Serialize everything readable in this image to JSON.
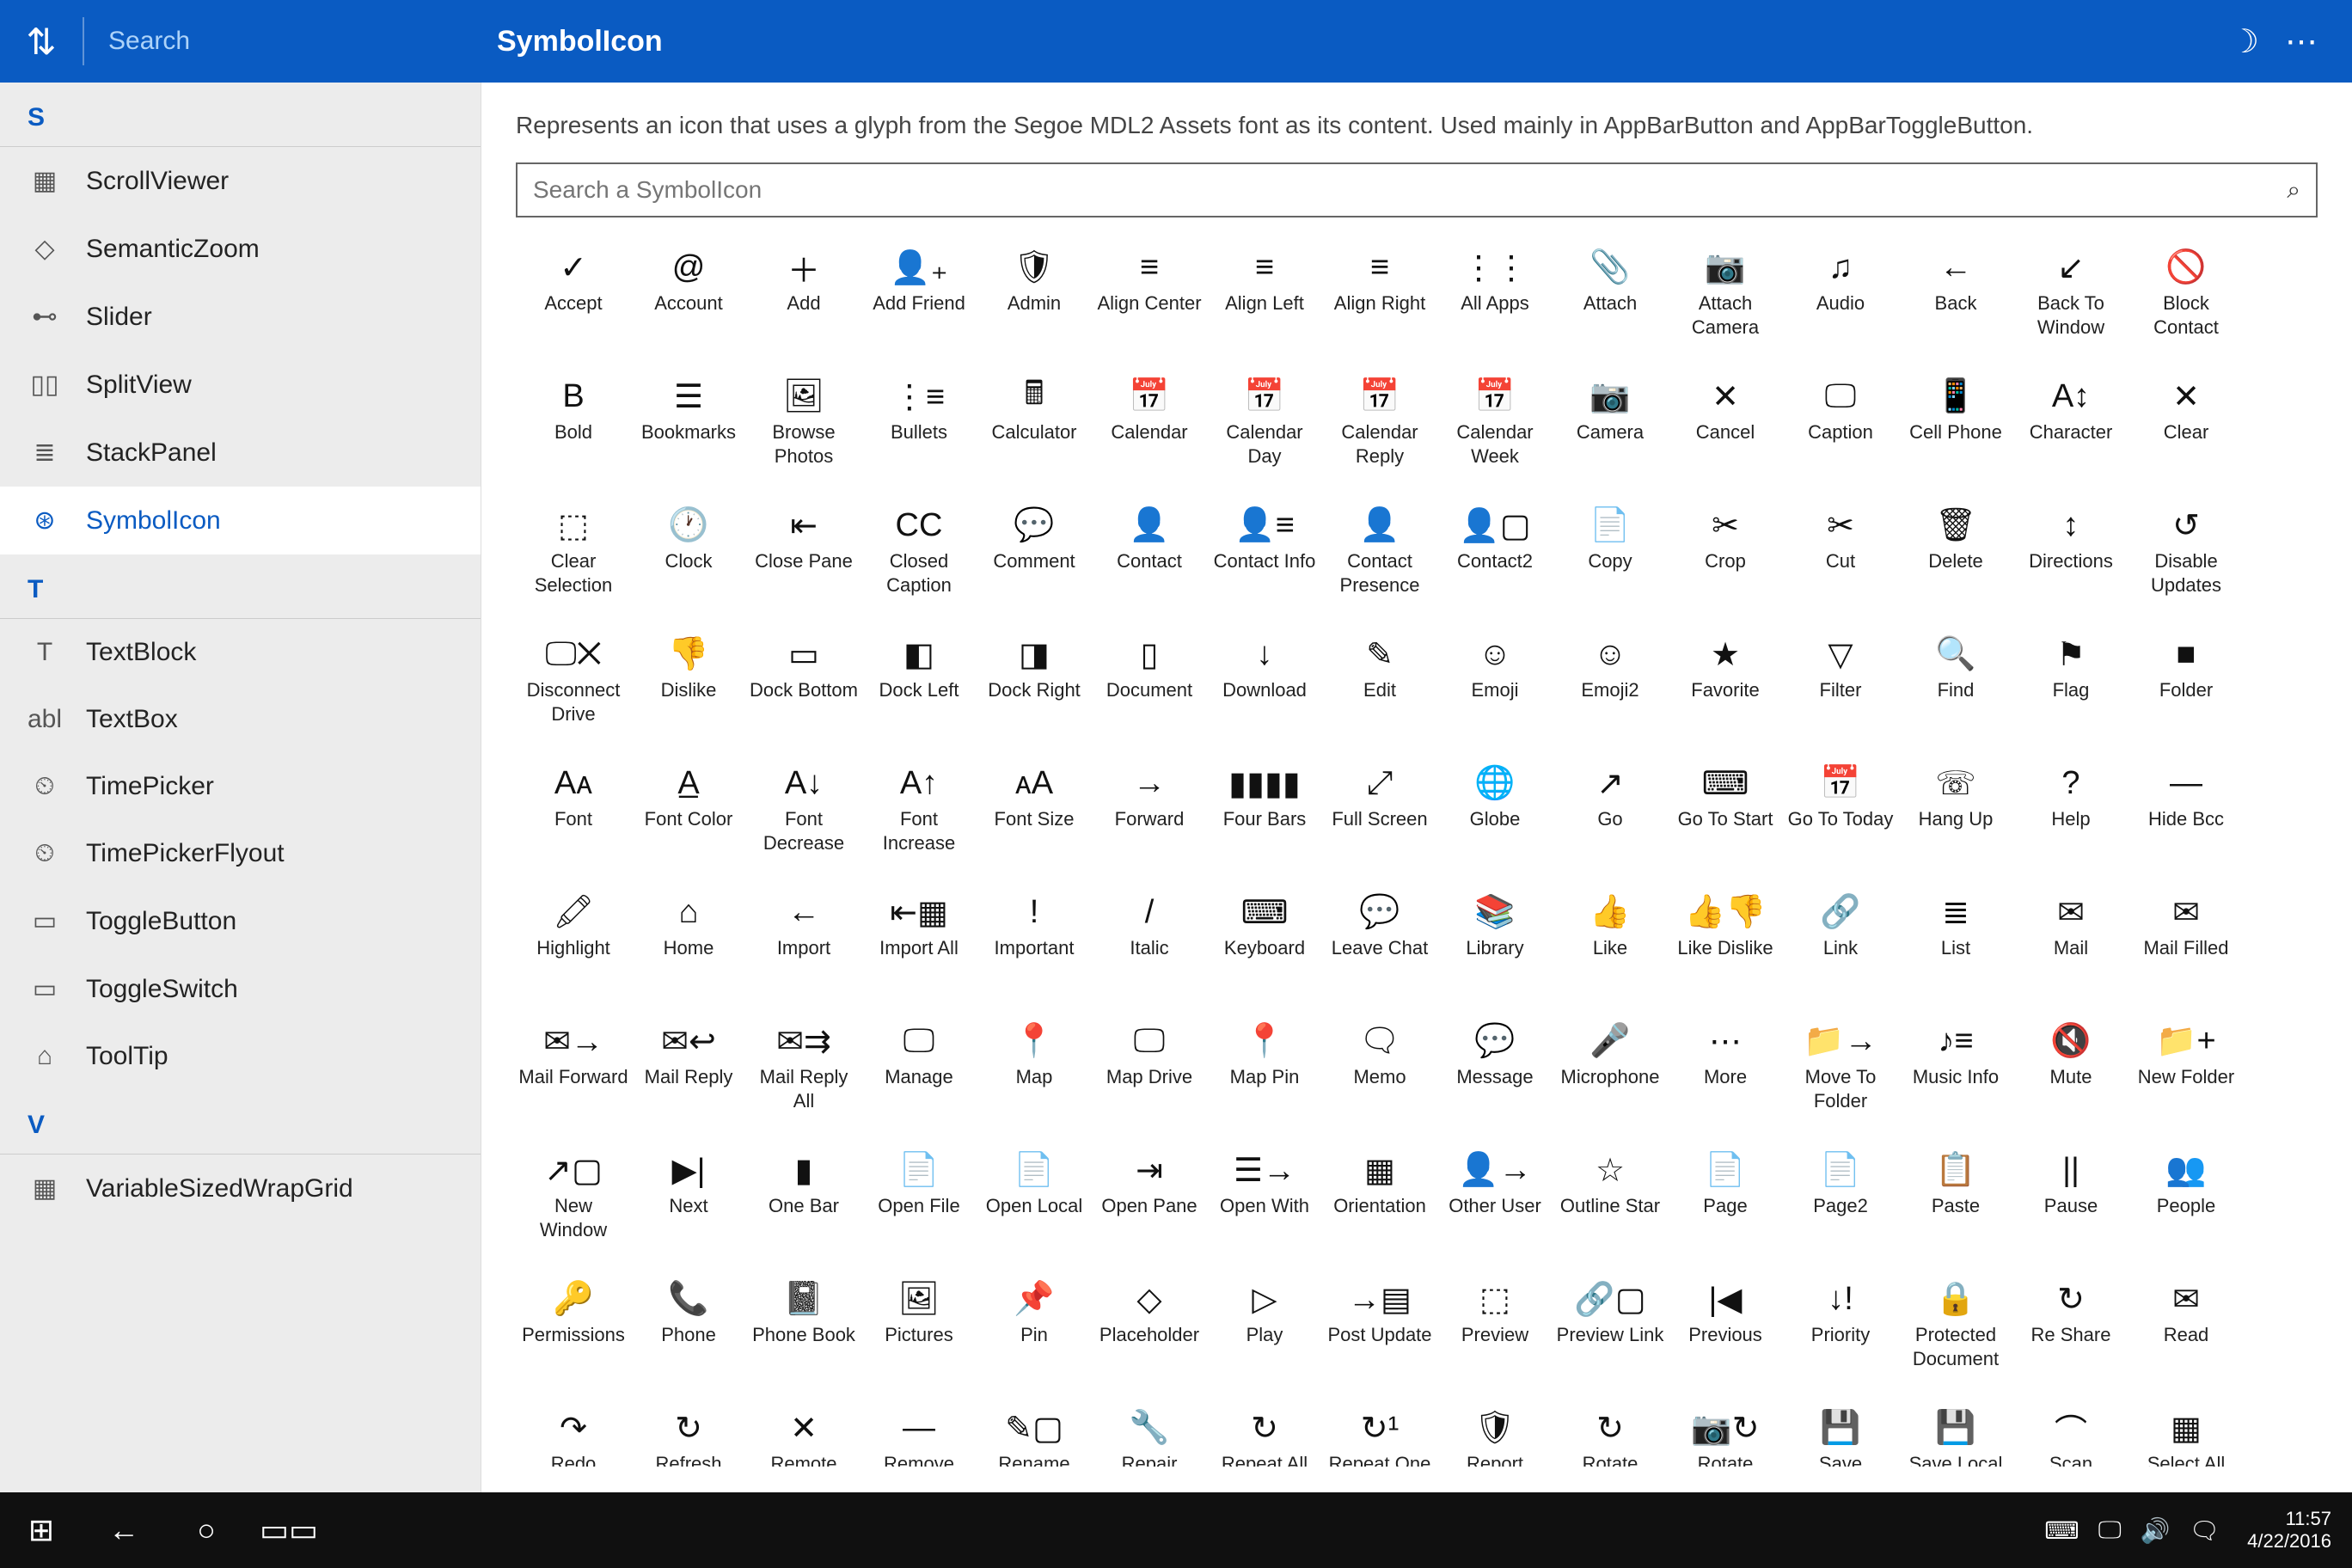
{
  "topbar": {
    "sort_glyph": "⇅",
    "search_placeholder": "Search",
    "title": "SymbolIcon",
    "theme_glyph": "☽",
    "more_glyph": "⋯"
  },
  "sidebar": {
    "groups": [
      {
        "letter": "S",
        "items": [
          {
            "icon": "▦",
            "label": "ScrollViewer",
            "id": "scrollviewer"
          },
          {
            "icon": "◇",
            "label": "SemanticZoom",
            "id": "semanticzoom"
          },
          {
            "icon": "⊷",
            "label": "Slider",
            "id": "slider"
          },
          {
            "icon": "▯▯",
            "label": "SplitView",
            "id": "splitview"
          },
          {
            "icon": "≣",
            "label": "StackPanel",
            "id": "stackpanel"
          },
          {
            "icon": "⊛",
            "label": "SymbolIcon",
            "id": "symbolicon",
            "active": true
          }
        ]
      },
      {
        "letter": "T",
        "items": [
          {
            "icon": "T",
            "label": "TextBlock",
            "id": "textblock"
          },
          {
            "icon": "abl",
            "label": "TextBox",
            "id": "textbox"
          },
          {
            "icon": "⏲",
            "label": "TimePicker",
            "id": "timepicker"
          },
          {
            "icon": "⏲",
            "label": "TimePickerFlyout",
            "id": "timepickerflyout"
          },
          {
            "icon": "▭",
            "label": "ToggleButton",
            "id": "togglebutton"
          },
          {
            "icon": "▭",
            "label": "ToggleSwitch",
            "id": "toggleswitch"
          },
          {
            "icon": "⌂",
            "label": "ToolTip",
            "id": "tooltip"
          }
        ]
      },
      {
        "letter": "V",
        "items": [
          {
            "icon": "▦",
            "label": "VariableSizedWrapGrid",
            "id": "variablesizedwrapgrid"
          }
        ]
      }
    ]
  },
  "content": {
    "description": "Represents an icon that uses a glyph from the Segoe MDL2 Assets font as its content. Used mainly in AppBarButton and AppBarToggleButton.",
    "search_placeholder": "Search a SymbolIcon",
    "search_icon_glyph": "⌕"
  },
  "symbols": [
    {
      "g": "✓",
      "l": "Accept"
    },
    {
      "g": "@",
      "l": "Account"
    },
    {
      "g": "＋",
      "l": "Add"
    },
    {
      "g": "👤₊",
      "l": "Add Friend"
    },
    {
      "g": "🛡",
      "l": "Admin"
    },
    {
      "g": "≡",
      "l": "Align Center"
    },
    {
      "g": "≡",
      "l": "Align Left"
    },
    {
      "g": "≡",
      "l": "Align Right"
    },
    {
      "g": "⋮⋮",
      "l": "All Apps"
    },
    {
      "g": "📎",
      "l": "Attach"
    },
    {
      "g": "📷",
      "l": "Attach Camera"
    },
    {
      "g": "♫",
      "l": "Audio"
    },
    {
      "g": "←",
      "l": "Back"
    },
    {
      "g": "↙",
      "l": "Back To Window"
    },
    {
      "g": "🚫",
      "l": "Block Contact"
    },
    {
      "g": "B",
      "l": "Bold"
    },
    {
      "g": "☰",
      "l": "Bookmarks"
    },
    {
      "g": "🖼",
      "l": "Browse Photos"
    },
    {
      "g": "⋮≡",
      "l": "Bullets"
    },
    {
      "g": "🖩",
      "l": "Calculator"
    },
    {
      "g": "📅",
      "l": "Calendar"
    },
    {
      "g": "📅",
      "l": "Calendar Day"
    },
    {
      "g": "📅",
      "l": "Calendar Reply"
    },
    {
      "g": "📅",
      "l": "Calendar Week"
    },
    {
      "g": "📷",
      "l": "Camera"
    },
    {
      "g": "✕",
      "l": "Cancel"
    },
    {
      "g": "🖵",
      "l": "Caption"
    },
    {
      "g": "📱",
      "l": "Cell Phone"
    },
    {
      "g": "A↕",
      "l": "Character"
    },
    {
      "g": "✕",
      "l": "Clear"
    },
    {
      "g": "⬚",
      "l": "Clear Selection"
    },
    {
      "g": "🕐",
      "l": "Clock"
    },
    {
      "g": "⇤",
      "l": "Close Pane"
    },
    {
      "g": "CC",
      "l": "Closed Caption"
    },
    {
      "g": "💬",
      "l": "Comment"
    },
    {
      "g": "👤",
      "l": "Contact"
    },
    {
      "g": "👤≡",
      "l": "Contact Info"
    },
    {
      "g": "👤",
      "l": "Contact Presence"
    },
    {
      "g": "👤▢",
      "l": "Contact2"
    },
    {
      "g": "📄",
      "l": "Copy"
    },
    {
      "g": "✂",
      "l": "Crop"
    },
    {
      "g": "✂",
      "l": "Cut"
    },
    {
      "g": "🗑",
      "l": "Delete"
    },
    {
      "g": "↕",
      "l": "Directions"
    },
    {
      "g": "↺",
      "l": "Disable Updates"
    },
    {
      "g": "🖵✕",
      "l": "Disconnect Drive"
    },
    {
      "g": "👎",
      "l": "Dislike"
    },
    {
      "g": "▭",
      "l": "Dock Bottom"
    },
    {
      "g": "◧",
      "l": "Dock Left"
    },
    {
      "g": "◨",
      "l": "Dock Right"
    },
    {
      "g": "▯",
      "l": "Document"
    },
    {
      "g": "↓",
      "l": "Download"
    },
    {
      "g": "✎",
      "l": "Edit"
    },
    {
      "g": "☺",
      "l": "Emoji"
    },
    {
      "g": "☺",
      "l": "Emoji2"
    },
    {
      "g": "★",
      "l": "Favorite"
    },
    {
      "g": "▽",
      "l": "Filter"
    },
    {
      "g": "🔍",
      "l": "Find"
    },
    {
      "g": "⚑",
      "l": "Flag"
    },
    {
      "g": "■",
      "l": "Folder"
    },
    {
      "g": "Aᴀ",
      "l": "Font"
    },
    {
      "g": "A̲",
      "l": "Font Color"
    },
    {
      "g": "A↓",
      "l": "Font Decrease"
    },
    {
      "g": "A↑",
      "l": "Font Increase"
    },
    {
      "g": "ᴀA",
      "l": "Font Size"
    },
    {
      "g": "→",
      "l": "Forward"
    },
    {
      "g": "▮▮▮▮",
      "l": "Four Bars"
    },
    {
      "g": "⤢",
      "l": "Full Screen"
    },
    {
      "g": "🌐",
      "l": "Globe"
    },
    {
      "g": "↗",
      "l": "Go"
    },
    {
      "g": "⌨",
      "l": "Go To Start"
    },
    {
      "g": "📅",
      "l": "Go To Today"
    },
    {
      "g": "☏",
      "l": "Hang Up"
    },
    {
      "g": "?",
      "l": "Help"
    },
    {
      "g": "—",
      "l": "Hide Bcc"
    },
    {
      "g": "🖍",
      "l": "Highlight"
    },
    {
      "g": "⌂",
      "l": "Home"
    },
    {
      "g": "←",
      "l": "Import"
    },
    {
      "g": "⇤▦",
      "l": "Import All"
    },
    {
      "g": "!",
      "l": "Important"
    },
    {
      "g": "/",
      "l": "Italic"
    },
    {
      "g": "⌨",
      "l": "Keyboard"
    },
    {
      "g": "💬",
      "l": "Leave Chat"
    },
    {
      "g": "📚",
      "l": "Library"
    },
    {
      "g": "👍",
      "l": "Like"
    },
    {
      "g": "👍👎",
      "l": "Like Dislike"
    },
    {
      "g": "🔗",
      "l": "Link"
    },
    {
      "g": "≣",
      "l": "List"
    },
    {
      "g": "✉",
      "l": "Mail"
    },
    {
      "g": "✉",
      "l": "Mail Filled"
    },
    {
      "g": "✉→",
      "l": "Mail Forward"
    },
    {
      "g": "✉↩",
      "l": "Mail Reply"
    },
    {
      "g": "✉⇉",
      "l": "Mail Reply All"
    },
    {
      "g": "🖵",
      "l": "Manage"
    },
    {
      "g": "📍",
      "l": "Map"
    },
    {
      "g": "🖵",
      "l": "Map Drive"
    },
    {
      "g": "📍",
      "l": "Map Pin"
    },
    {
      "g": "🗨",
      "l": "Memo"
    },
    {
      "g": "💬",
      "l": "Message"
    },
    {
      "g": "🎤",
      "l": "Microphone"
    },
    {
      "g": "⋯",
      "l": "More"
    },
    {
      "g": "📁→",
      "l": "Move To Folder"
    },
    {
      "g": "♪≡",
      "l": "Music Info"
    },
    {
      "g": "🔇",
      "l": "Mute"
    },
    {
      "g": "📁+",
      "l": "New Folder"
    },
    {
      "g": "↗▢",
      "l": "New Window"
    },
    {
      "g": "▶|",
      "l": "Next"
    },
    {
      "g": "▮",
      "l": "One Bar"
    },
    {
      "g": "📄",
      "l": "Open File"
    },
    {
      "g": "📄",
      "l": "Open Local"
    },
    {
      "g": "⇥",
      "l": "Open Pane"
    },
    {
      "g": "☰→",
      "l": "Open With"
    },
    {
      "g": "▦",
      "l": "Orientation"
    },
    {
      "g": "👤→",
      "l": "Other User"
    },
    {
      "g": "☆",
      "l": "Outline Star"
    },
    {
      "g": "📄",
      "l": "Page"
    },
    {
      "g": "📄",
      "l": "Page2"
    },
    {
      "g": "📋",
      "l": "Paste"
    },
    {
      "g": "||",
      "l": "Pause"
    },
    {
      "g": "👥",
      "l": "People"
    },
    {
      "g": "🔑",
      "l": "Permissions"
    },
    {
      "g": "📞",
      "l": "Phone"
    },
    {
      "g": "📓",
      "l": "Phone Book"
    },
    {
      "g": "🖼",
      "l": "Pictures"
    },
    {
      "g": "📌",
      "l": "Pin"
    },
    {
      "g": "◇",
      "l": "Placeholder"
    },
    {
      "g": "▷",
      "l": "Play"
    },
    {
      "g": "→▤",
      "l": "Post Update"
    },
    {
      "g": "⬚",
      "l": "Preview"
    },
    {
      "g": "🔗▢",
      "l": "Preview Link"
    },
    {
      "g": "|◀",
      "l": "Previous"
    },
    {
      "g": "↓!",
      "l": "Priority"
    },
    {
      "g": "🔒",
      "l": "Protected Document"
    },
    {
      "g": "↻",
      "l": "Re Share"
    },
    {
      "g": "✉",
      "l": "Read"
    },
    {
      "g": "↷",
      "l": "Redo"
    },
    {
      "g": "↻",
      "l": "Refresh"
    },
    {
      "g": "✕",
      "l": "Remote"
    },
    {
      "g": "—",
      "l": "Remove"
    },
    {
      "g": "✎▢",
      "l": "Rename"
    },
    {
      "g": "🔧",
      "l": "Repair"
    },
    {
      "g": "↻",
      "l": "Repeat All"
    },
    {
      "g": "↻¹",
      "l": "Repeat One"
    },
    {
      "g": "🛡",
      "l": "Report"
    },
    {
      "g": "↻",
      "l": "Rotate"
    },
    {
      "g": "📷↻",
      "l": "Rotate"
    },
    {
      "g": "💾",
      "l": "Save"
    },
    {
      "g": "💾",
      "l": "Save Local"
    },
    {
      "g": "⌒",
      "l": "Scan"
    },
    {
      "g": "▦",
      "l": "Select All"
    }
  ],
  "taskbar": {
    "start_glyph": "⊞",
    "back_glyph": "←",
    "cortana_glyph": "○",
    "taskview_glyph": "▭▭",
    "tray": [
      "⌨",
      "🖵",
      "🔊",
      "🗨"
    ],
    "time": "11:57",
    "date": "4/22/2016"
  }
}
